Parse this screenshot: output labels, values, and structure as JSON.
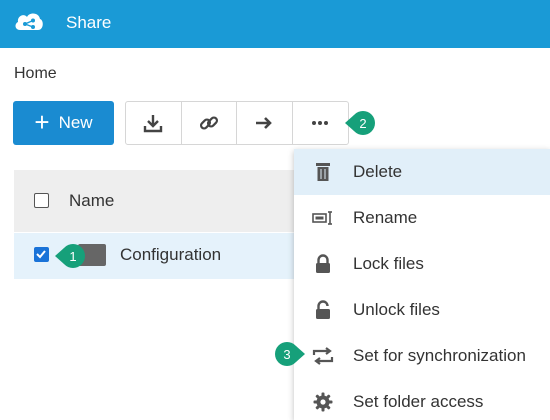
{
  "app": {
    "title": "Share"
  },
  "breadcrumb": {
    "home": "Home"
  },
  "toolbar": {
    "new_label": "New",
    "buttons": [
      {
        "icon": "download-icon"
      },
      {
        "icon": "link-icon"
      },
      {
        "icon": "arrow-right-icon"
      },
      {
        "icon": "more-icon"
      }
    ]
  },
  "table": {
    "header": {
      "name": "Name"
    },
    "rows": [
      {
        "name": "Configuration",
        "checked": true
      }
    ]
  },
  "context_menu": {
    "items": [
      {
        "label": "Delete",
        "icon": "trash-icon"
      },
      {
        "label": "Rename",
        "icon": "rename-icon"
      },
      {
        "label": "Lock files",
        "icon": "lock-icon"
      },
      {
        "label": "Unlock files",
        "icon": "unlock-icon"
      },
      {
        "label": "Set for synchronization",
        "icon": "sync-icon"
      },
      {
        "label": "Set folder access",
        "icon": "gear-icon"
      }
    ]
  },
  "callouts": [
    "1",
    "2",
    "3"
  ],
  "colors": {
    "topbar": "#1a9ad6",
    "primary": "#1a8bd1",
    "callout": "#16a07a",
    "selected_row": "#e5f2fb",
    "active_menu": "#e1eff9"
  }
}
